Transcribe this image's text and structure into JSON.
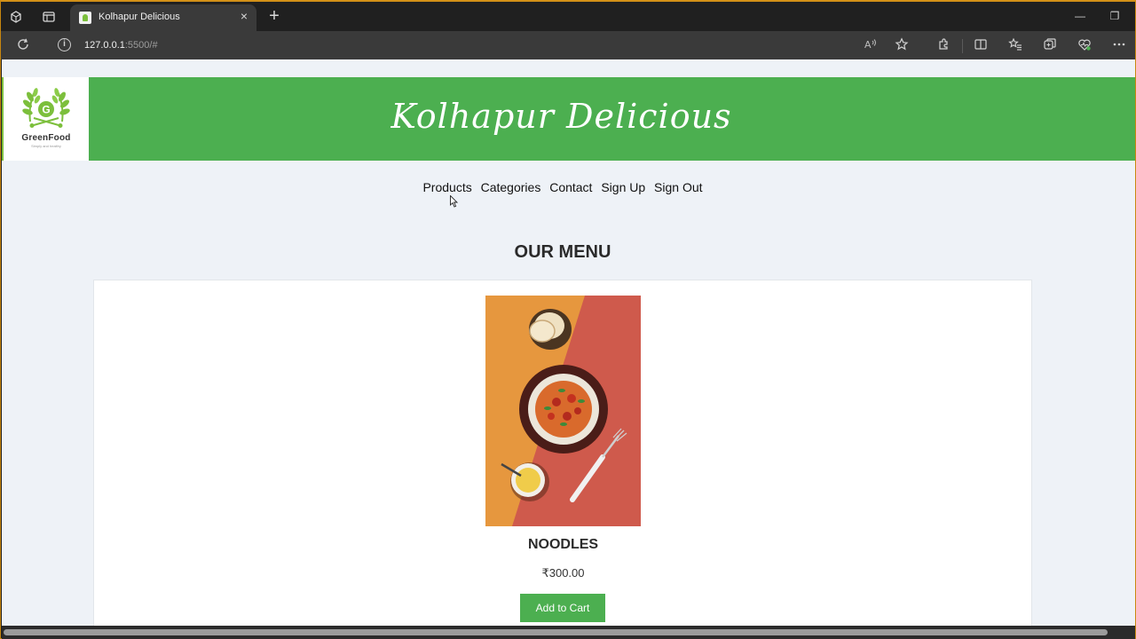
{
  "browser": {
    "tab_title": "Kolhapur Delicious",
    "tab_close_glyph": "×",
    "new_tab_glyph": "+",
    "url_host": "127.0.0.1",
    "url_rest": ":5500/#",
    "window_controls": {
      "minimize": "—",
      "maximize": "❐"
    }
  },
  "header": {
    "logo_name": "GreenFood",
    "logo_tagline": "Simply and healthy",
    "site_title": "Kolhapur Delicious",
    "brand_color": "#4caf50"
  },
  "nav": {
    "items": [
      "Products",
      "Categories",
      "Contact",
      "Sign Up",
      "Sign Out"
    ]
  },
  "menu": {
    "heading": "OUR MENU",
    "products": [
      {
        "name": "NOODLES",
        "price": "₹300.00",
        "button_label": "Add to Cart",
        "image": "noodles-bowl-photo"
      }
    ]
  }
}
